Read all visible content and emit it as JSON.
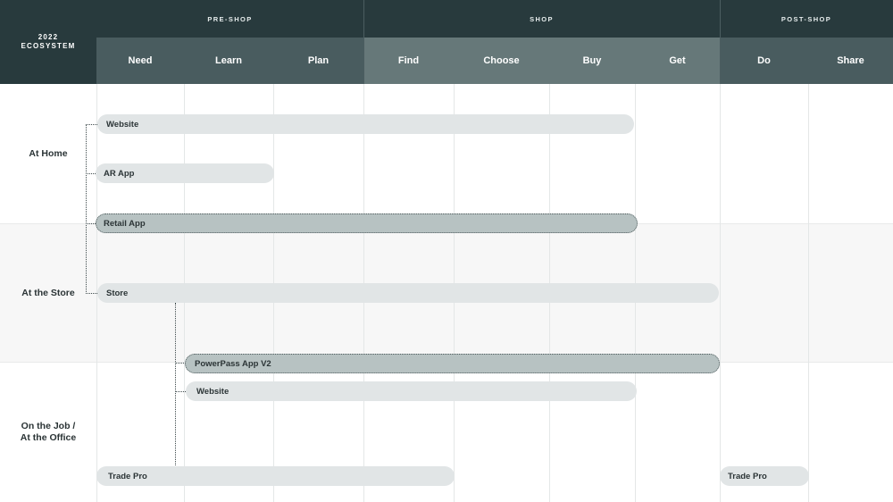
{
  "corner": {
    "year": "2022",
    "label": "ECOSYSTEM"
  },
  "phases": [
    "PRE-SHOP",
    "SHOP",
    "POST-SHOP"
  ],
  "steps": [
    "Need",
    "Learn",
    "Plan",
    "Find",
    "Choose",
    "Buy",
    "Get",
    "Do",
    "Share"
  ],
  "rows": [
    {
      "label": "At Home"
    },
    {
      "label": "At the Store"
    },
    {
      "label_line1": "On the Job /",
      "label_line2": "At the Office"
    }
  ],
  "bars": {
    "home_website": "Website",
    "ar_app": "AR App",
    "retail_app": "Retail App",
    "store": "Store",
    "powerpass": "PowerPass App V2",
    "job_website": "Website",
    "trade_pro_1": "Trade Pro",
    "trade_pro_2": "Trade Pro"
  },
  "colors": {
    "header_dark": "#283a3d",
    "step_dark": "#495c5f",
    "step_light": "#667879",
    "channel_bar": "#e1e5e6",
    "app_bar": "#b7c2c2"
  }
}
